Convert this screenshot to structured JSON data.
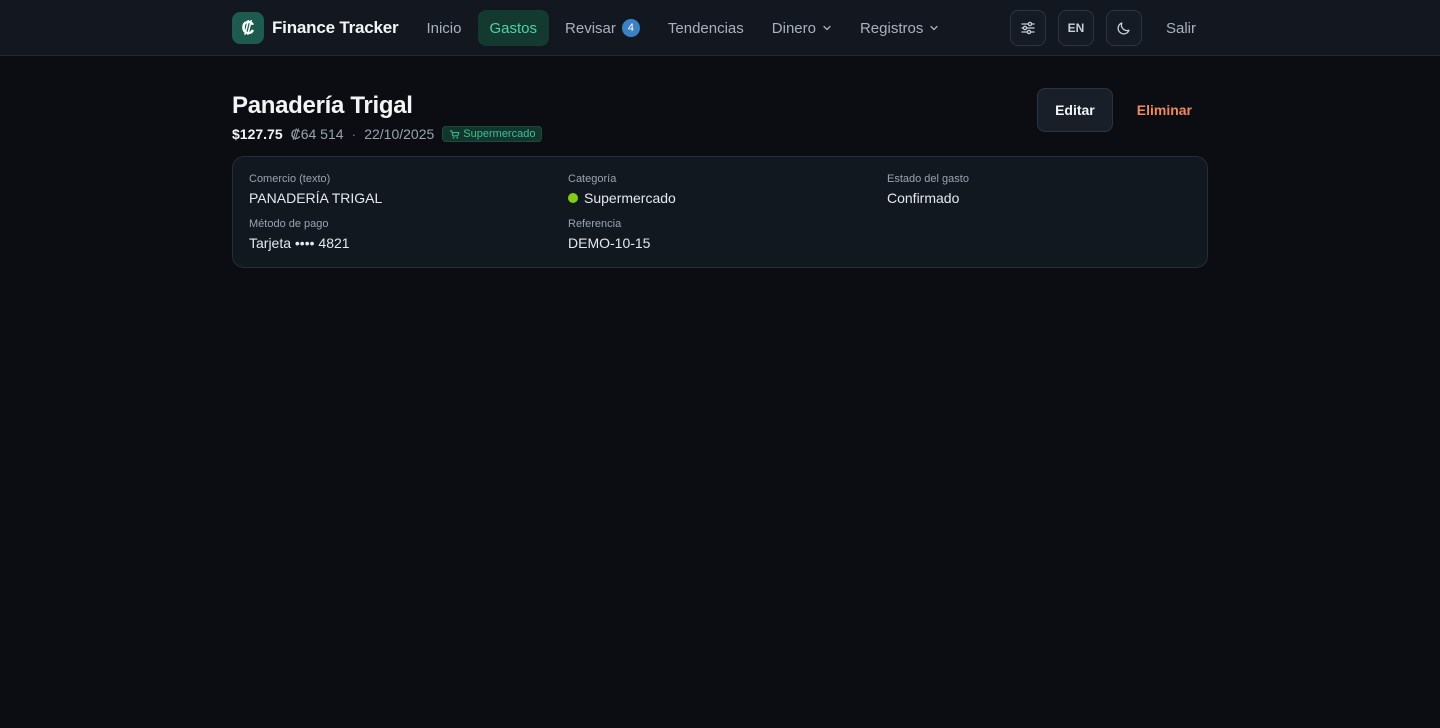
{
  "app": {
    "name": "Finance Tracker",
    "logo_glyph": "₡"
  },
  "nav": {
    "links": [
      {
        "label": "Inicio"
      },
      {
        "label": "Gastos",
        "active": true
      },
      {
        "label": "Revisar",
        "badge": "4"
      },
      {
        "label": "Tendencias"
      },
      {
        "label": "Dinero",
        "dropdown": true
      },
      {
        "label": "Registros",
        "dropdown": true
      }
    ],
    "lang": "EN",
    "logout": "Salir"
  },
  "expense": {
    "title": "Panadería Trigal",
    "amount": "$127.75",
    "amount_local": "₡64 514",
    "separator": "·",
    "date": "22/10/2025",
    "category_tag": "Supermercado",
    "edit_label": "Editar",
    "delete_label": "Eliminar"
  },
  "details": {
    "merchant": {
      "label": "Comercio (texto)",
      "value": "PANADERÍA TRIGAL"
    },
    "category": {
      "label": "Categoría",
      "value": "Supermercado"
    },
    "status": {
      "label": "Estado del gasto",
      "value": "Confirmado"
    },
    "payment": {
      "label": "Método de pago",
      "value": "Tarjeta •••• 4821"
    },
    "reference": {
      "label": "Referencia",
      "value": "DEMO-10-15"
    }
  },
  "colors": {
    "accent": "#4fd1a5",
    "danger": "#f08a5d",
    "badge": "#3b82c4",
    "category_dot": "#84cc16"
  },
  "icons": [
    "sliders-icon",
    "moon-icon",
    "cart-icon",
    "chevron-down-icon"
  ]
}
